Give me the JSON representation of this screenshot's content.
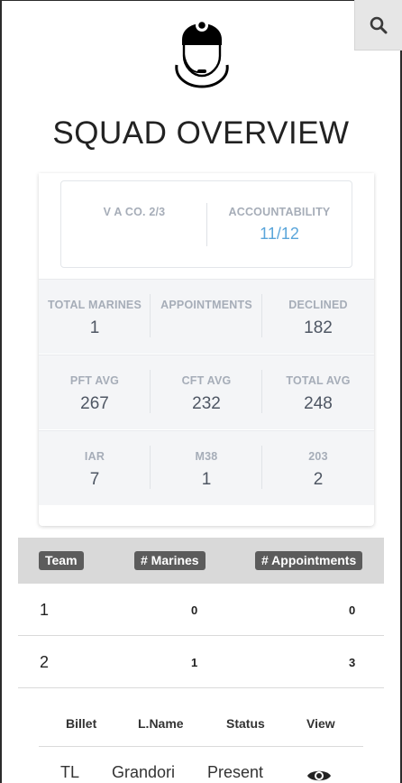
{
  "header": {
    "title": "SQUAD OVERVIEW",
    "search_icon": "search-icon",
    "logo_icon": "marine-helmet-logo"
  },
  "summary": {
    "unit_label": "V A CO. 2/3",
    "accountability_label": "ACCOUNTABILITY",
    "accountability_value": "11/12"
  },
  "stats": [
    [
      {
        "label": "TOTAL MARINES",
        "value": "1"
      },
      {
        "label": "APPOINTMENTS",
        "value": ""
      },
      {
        "label": "DECLINED",
        "value": "182"
      }
    ],
    [
      {
        "label": "PFT AVG",
        "value": "267"
      },
      {
        "label": "CFT AVG",
        "value": "232"
      },
      {
        "label": "TOTAL AVG",
        "value": "248"
      }
    ],
    [
      {
        "label": "IAR",
        "value": "7"
      },
      {
        "label": "M38",
        "value": "1"
      },
      {
        "label": "203",
        "value": "2"
      }
    ]
  ],
  "teams_table": {
    "headers": [
      "Team",
      "# Marines",
      "# Appointments"
    ],
    "rows": [
      {
        "team": "1",
        "marines": "0",
        "appointments": "0"
      },
      {
        "team": "2",
        "marines": "1",
        "appointments": "3"
      }
    ]
  },
  "members_table": {
    "headers": [
      "Billet",
      "L.Name",
      "Status",
      "View"
    ],
    "rows": [
      {
        "billet": "TL",
        "lname": "Grandori",
        "status": "Present",
        "view_icon": "eye-icon"
      }
    ]
  },
  "colors": {
    "accent": "#5aa5da",
    "header_pill": "#5c5c5c",
    "stat_bg": "#f4f5f7"
  }
}
